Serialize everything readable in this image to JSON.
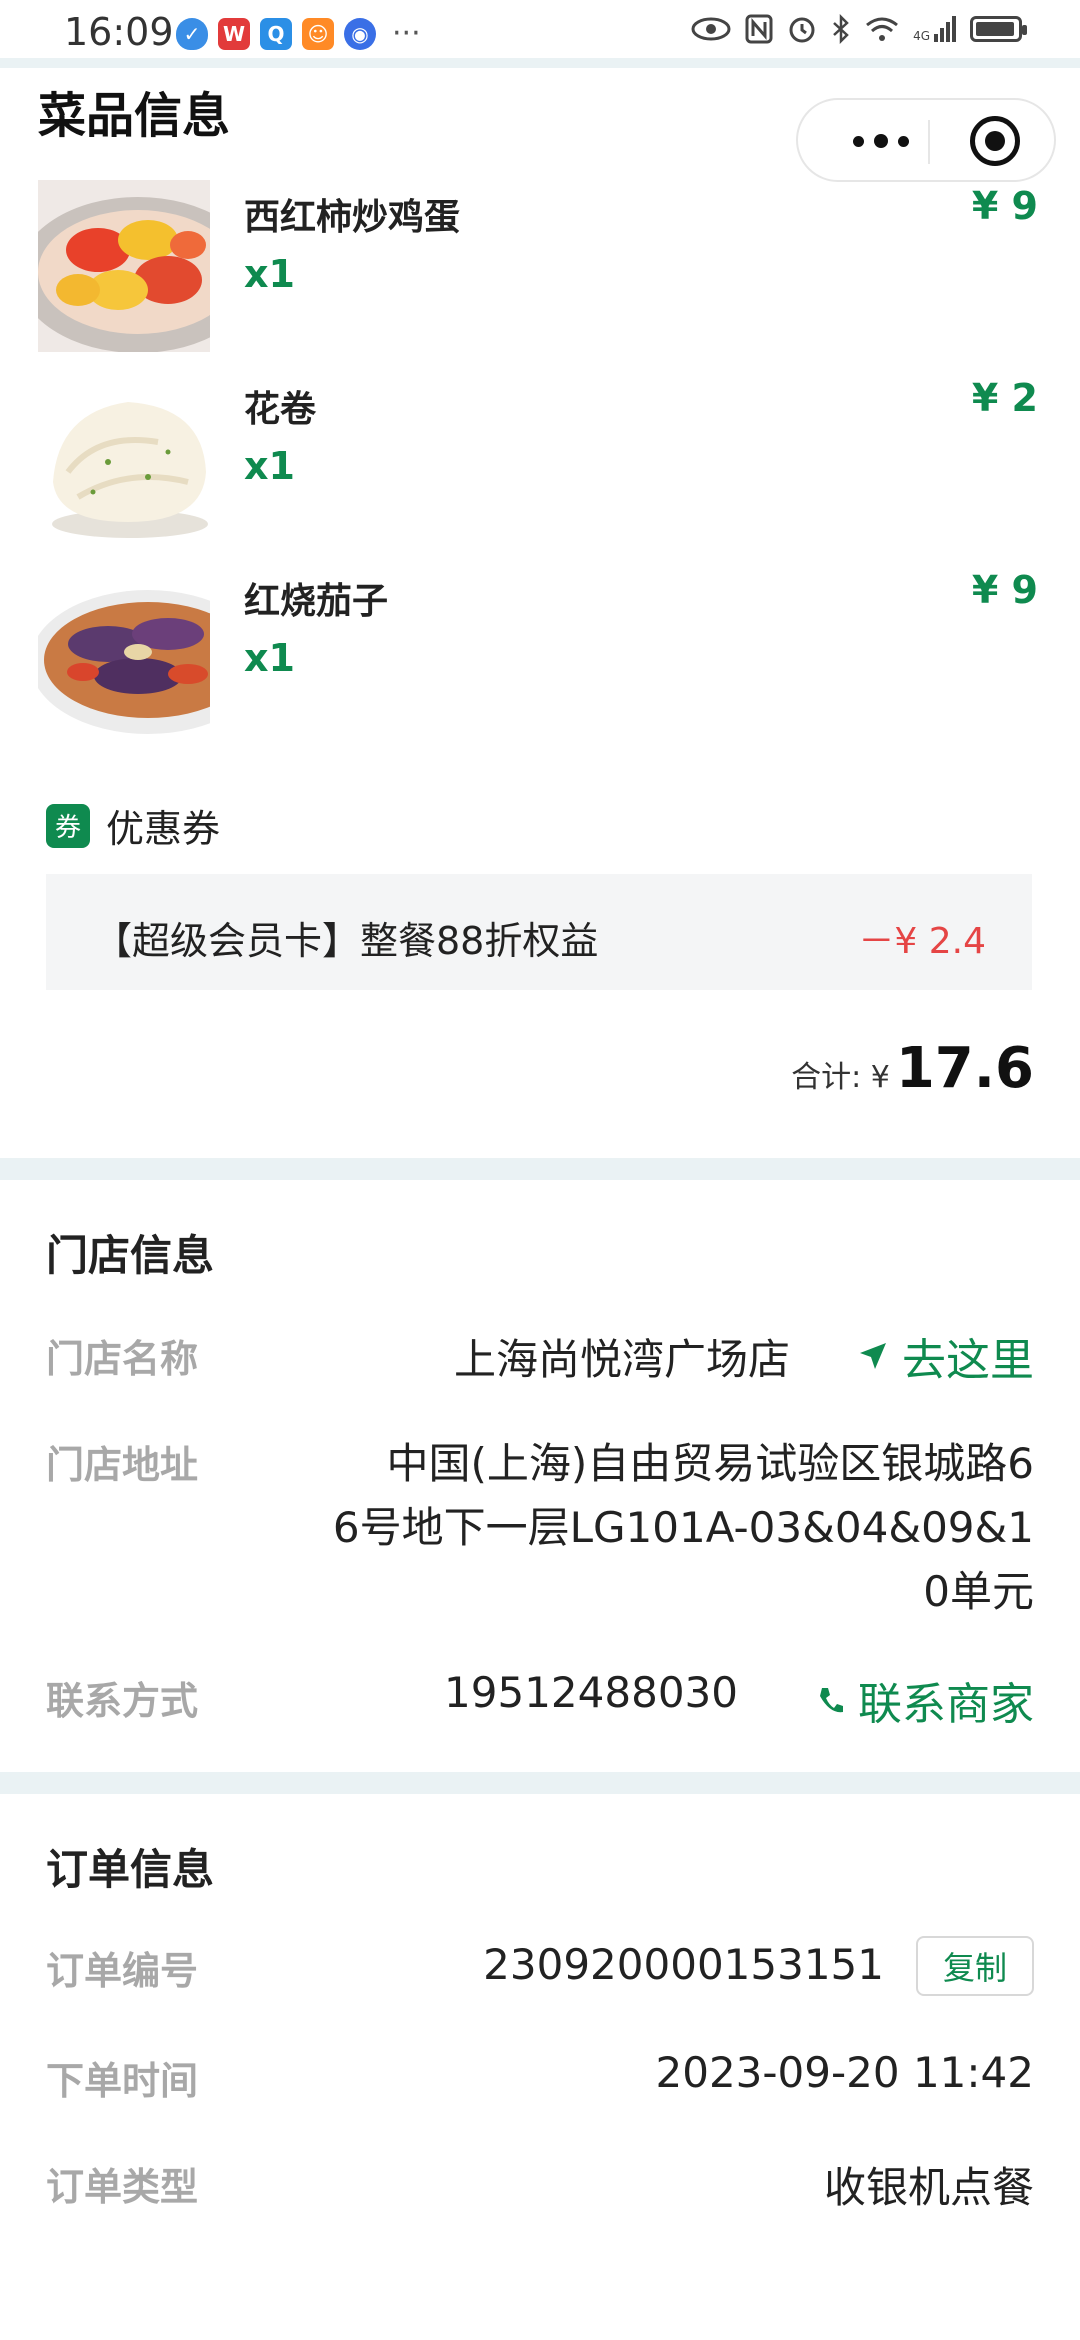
{
  "status_bar": {
    "time": "16:09",
    "network": "4G",
    "apps": [
      {
        "name": "shield-app-icon",
        "color": "#3a8ee6",
        "glyph": "⛊"
      },
      {
        "name": "wps-app-icon",
        "color": "#e23b3b",
        "glyph": "W"
      },
      {
        "name": "search-app-icon",
        "color": "#2b8fe6",
        "glyph": "Q"
      },
      {
        "name": "taobao-app-icon",
        "color": "#ff8a26",
        "glyph": "☺"
      },
      {
        "name": "browser-app-icon",
        "color": "#3a6fe6",
        "glyph": "◉"
      }
    ],
    "more": "···"
  },
  "header": {
    "title": "菜品信息"
  },
  "dishes": [
    {
      "name": "西红柿炒鸡蛋",
      "qty": "x1",
      "price": "¥ 9"
    },
    {
      "name": "花卷",
      "qty": "x1",
      "price": "¥ 2"
    },
    {
      "name": "红烧茄子",
      "qty": "x1",
      "price": "¥ 9"
    }
  ],
  "coupon": {
    "badge": "券",
    "title": "优惠券",
    "name": "【超级会员卡】整餐88折权益",
    "discount": "－¥ 2.4"
  },
  "total": {
    "label": "合计: ¥",
    "value": "17.6"
  },
  "store": {
    "section_title": "门店信息",
    "name_label": "门店名称",
    "name": "上海尚悦湾广场店",
    "navigate": "去这里",
    "address_label": "门店地址",
    "address_lines": [
      "中国(上海)自由贸易试验区银城路6",
      "6号地下一层LG101A-03&04&09&1",
      "0单元"
    ],
    "contact_label": "联系方式",
    "phone": "19512488030",
    "contact_merchant": "联系商家"
  },
  "order": {
    "section_title": "订单信息",
    "number_label": "订单编号",
    "number": "230920000153151",
    "copy": "复制",
    "time_label": "下单时间",
    "time": "2023-09-20 11:42",
    "type_label": "订单类型",
    "type": "收银机点餐"
  },
  "colors": {
    "accent_green": "#0f8a4f",
    "discount_red": "#e54545",
    "divider": "#eaf2f4"
  }
}
